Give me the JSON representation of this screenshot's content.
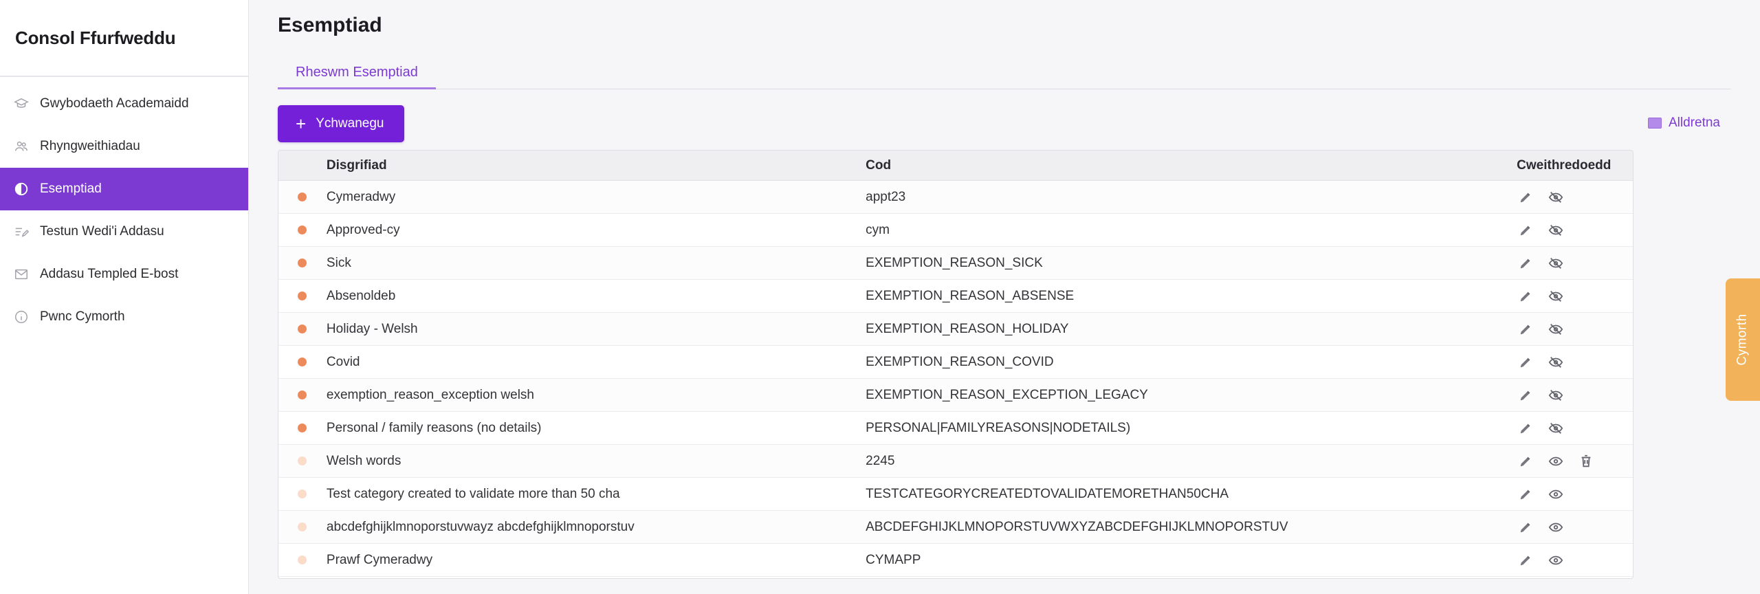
{
  "app": {
    "title": "Consol Ffurfweddu"
  },
  "sidebar": {
    "items": [
      {
        "label": "Gwybodaeth Academaidd",
        "icon": "graduation-cap-icon",
        "active": false
      },
      {
        "label": "Rhyngweithiadau",
        "icon": "users-icon",
        "active": false
      },
      {
        "label": "Esemptiad",
        "icon": "half-circle-icon",
        "active": true
      },
      {
        "label": "Testun Wedi'i Addasu",
        "icon": "edit-text-icon",
        "active": false
      },
      {
        "label": "Addasu Templed E-bost",
        "icon": "envelope-icon",
        "active": false
      },
      {
        "label": "Pwnc Cymorth",
        "icon": "info-icon",
        "active": false
      }
    ]
  },
  "page": {
    "title": "Esemptiad",
    "tab_label": "Rheswm Esemptiad",
    "add_button_label": "Ychwanegu",
    "legend_label": "Alldretna"
  },
  "table": {
    "headers": {
      "description": "Disgrifiad",
      "code": "Cod",
      "actions": "Cweithredoedd"
    },
    "rows": [
      {
        "description": "Cymeradwy",
        "code": "appt23",
        "status": "active"
      },
      {
        "description": "Approved-cy",
        "code": "cym",
        "status": "active"
      },
      {
        "description": "Sick",
        "code": "EXEMPTION_REASON_SICK",
        "status": "active"
      },
      {
        "description": "Absenoldeb",
        "code": "EXEMPTION_REASON_ABSENSE",
        "status": "active"
      },
      {
        "description": "Holiday - Welsh",
        "code": "EXEMPTION_REASON_HOLIDAY",
        "status": "active"
      },
      {
        "description": "Covid",
        "code": "EXEMPTION_REASON_COVID",
        "status": "active"
      },
      {
        "description": "exemption_reason_exception welsh",
        "code": "EXEMPTION_REASON_EXCEPTION_LEGACY",
        "status": "active"
      },
      {
        "description": "Personal / family reasons (no details)",
        "code": "PERSONAL|FAMILYREASONS|NODETAILS)",
        "status": "active"
      },
      {
        "description": "Welsh words",
        "code": "2245",
        "status": "inactive",
        "delete": true
      },
      {
        "description": "Test category created to validate more than 50 cha",
        "code": "TESTCATEGORYCREATEDTOVALIDATEMORETHAN50CHA",
        "status": "inactive"
      },
      {
        "description": "abcdefghijklmnoporstuvwayz abcdefghijklmnoporstuv",
        "code": "ABCDEFGHIJKLMNOPORSTUVWXYZABCDEFGHIJKLMNOPORSTUV",
        "status": "inactive"
      },
      {
        "description": "Prawf Cymeradwy",
        "code": "CYMAPP",
        "status": "inactive"
      }
    ]
  },
  "side_tab": {
    "label": "Cymorth"
  },
  "colors": {
    "accent": "#7c3ad2",
    "button": "#7420d8",
    "active_dot": "#ec8a5c",
    "inactive_dot": "#fbdcc9",
    "side_tab": "#f1b259"
  }
}
